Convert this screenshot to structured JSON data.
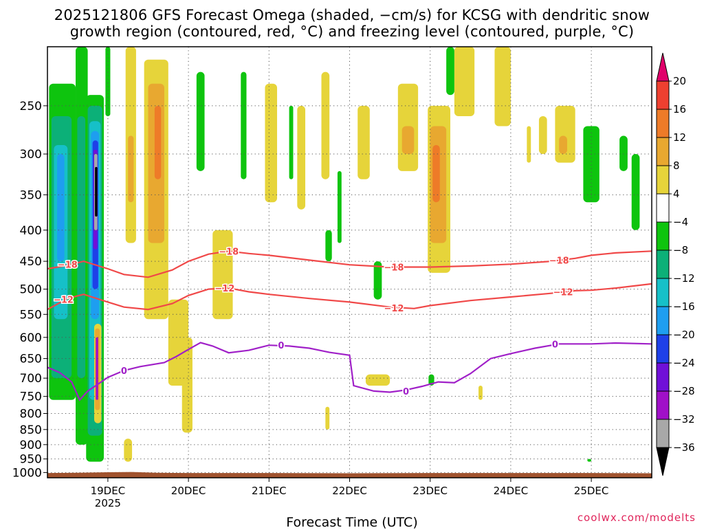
{
  "title_line1": "2025121806 GFS Forecast Omega (shaded, −cm/s) for KCSG with dendritic snow",
  "title_line2": "growth region (contoured, red, °C) and freezing level (contoured, purple, °C)",
  "xlabel": "Forecast Time (UTC)",
  "credit": "coolwx.com/modelts",
  "chart_data": {
    "type": "heatmap",
    "x_tick_labels": [
      "19DEC",
      "20DEC",
      "21DEC",
      "22DEC",
      "23DEC",
      "24DEC",
      "25DEC"
    ],
    "x_tick_days": [
      19,
      20,
      21,
      22,
      23,
      24,
      25
    ],
    "x_year_label": "2025",
    "x_range_days": [
      18.25,
      25.75
    ],
    "y_tick_labels": [
      "250",
      "300",
      "350",
      "400",
      "450",
      "500",
      "550",
      "600",
      "650",
      "700",
      "750",
      "800",
      "850",
      "900",
      "950",
      "1000"
    ],
    "y_ticks_hpa": [
      250,
      300,
      350,
      400,
      450,
      500,
      550,
      600,
      650,
      700,
      750,
      800,
      850,
      900,
      950,
      1000
    ],
    "y_range_hpa": [
      200,
      1020
    ],
    "y_scale": "log-pressure",
    "grid": true,
    "colorbar": {
      "levels": [
        20,
        16,
        12,
        8,
        4,
        -4,
        -8,
        -12,
        -16,
        -20,
        -24,
        -28,
        -32,
        -36
      ],
      "labels": [
        "20",
        "16",
        "12",
        "8",
        "4",
        "−4",
        "−8",
        "−12",
        "−16",
        "−20",
        "−24",
        "−28",
        "−32",
        "−36"
      ],
      "colors": [
        "#e0006a",
        "#ee4030",
        "#ee7b28",
        "#e8a830",
        "#e6d43a",
        "#ffffff",
        "#0ec40e",
        "#0cb078",
        "#16c0c8",
        "#1e9ef0",
        "#1e40e8",
        "#7010d8",
        "#a010c8",
        "#a8a8a8",
        "#000000"
      ]
    },
    "dgz_contours": [
      {
        "level": "-18",
        "color": "#f04848",
        "points": [
          [
            18.25,
            463
          ],
          [
            18.5,
            457
          ],
          [
            18.7,
            450
          ],
          [
            19.0,
            463
          ],
          [
            19.2,
            473
          ],
          [
            19.5,
            478
          ],
          [
            19.8,
            465
          ],
          [
            20.0,
            450
          ],
          [
            20.25,
            438
          ],
          [
            20.5,
            433
          ],
          [
            20.75,
            437
          ],
          [
            21.0,
            440
          ],
          [
            21.5,
            448
          ],
          [
            22.0,
            456
          ],
          [
            22.5,
            460
          ],
          [
            23.0,
            460
          ],
          [
            23.5,
            458
          ],
          [
            24.0,
            455
          ],
          [
            24.5,
            450
          ],
          [
            24.8,
            445
          ],
          [
            25.0,
            440
          ],
          [
            25.3,
            436
          ],
          [
            25.75,
            433
          ]
        ]
      },
      {
        "level": "-12",
        "color": "#f04848",
        "points": [
          [
            18.25,
            540
          ],
          [
            18.5,
            518
          ],
          [
            18.7,
            510
          ],
          [
            19.0,
            525
          ],
          [
            19.2,
            535
          ],
          [
            19.5,
            540
          ],
          [
            19.8,
            528
          ],
          [
            20.0,
            512
          ],
          [
            20.25,
            500
          ],
          [
            20.5,
            498
          ],
          [
            20.75,
            505
          ],
          [
            21.0,
            510
          ],
          [
            21.5,
            518
          ],
          [
            22.0,
            525
          ],
          [
            22.5,
            535
          ],
          [
            22.8,
            538
          ],
          [
            23.0,
            532
          ],
          [
            23.5,
            522
          ],
          [
            24.0,
            515
          ],
          [
            24.5,
            508
          ],
          [
            24.8,
            503
          ],
          [
            25.0,
            502
          ],
          [
            25.3,
            498
          ],
          [
            25.75,
            490
          ]
        ]
      },
      {
        "level": "0",
        "color": "#a020c8",
        "points": [
          [
            18.25,
            672
          ],
          [
            18.4,
            685
          ],
          [
            18.55,
            710
          ],
          [
            18.65,
            760
          ],
          [
            18.75,
            735
          ],
          [
            18.85,
            720
          ],
          [
            19.0,
            698
          ],
          [
            19.2,
            680
          ],
          [
            19.4,
            670
          ],
          [
            19.7,
            660
          ],
          [
            19.85,
            645
          ],
          [
            20.0,
            628
          ],
          [
            20.15,
            612
          ],
          [
            20.3,
            620
          ],
          [
            20.5,
            636
          ],
          [
            20.75,
            630
          ],
          [
            21.0,
            618
          ],
          [
            21.25,
            620
          ],
          [
            21.5,
            625
          ],
          [
            21.75,
            635
          ],
          [
            22.0,
            642
          ],
          [
            22.05,
            720
          ],
          [
            22.3,
            735
          ],
          [
            22.5,
            738
          ],
          [
            22.7,
            732
          ],
          [
            22.9,
            722
          ],
          [
            23.1,
            710
          ],
          [
            23.3,
            712
          ],
          [
            23.5,
            688
          ],
          [
            23.75,
            650
          ],
          [
            24.0,
            638
          ],
          [
            24.3,
            625
          ],
          [
            24.6,
            615
          ],
          [
            25.0,
            615
          ],
          [
            25.3,
            613
          ],
          [
            25.75,
            615
          ]
        ]
      }
    ],
    "contour_labels": [
      {
        "text": "−18",
        "x": 18.5,
        "p": 455
      },
      {
        "text": "−18",
        "x": 20.5,
        "p": 433
      },
      {
        "text": "−18",
        "x": 22.55,
        "p": 460
      },
      {
        "text": "−18",
        "x": 24.6,
        "p": 448
      },
      {
        "text": "−12",
        "x": 18.45,
        "p": 520
      },
      {
        "text": "−12",
        "x": 20.45,
        "p": 498
      },
      {
        "text": "−12",
        "x": 22.55,
        "p": 537
      },
      {
        "text": "−12",
        "x": 24.65,
        "p": 505
      },
      {
        "text": "0",
        "x": 19.2,
        "p": 680
      },
      {
        "text": "0",
        "x": 21.15,
        "p": 618
      },
      {
        "text": "0",
        "x": 22.7,
        "p": 735
      },
      {
        "text": "0",
        "x": 24.55,
        "p": 615
      }
    ]
  }
}
